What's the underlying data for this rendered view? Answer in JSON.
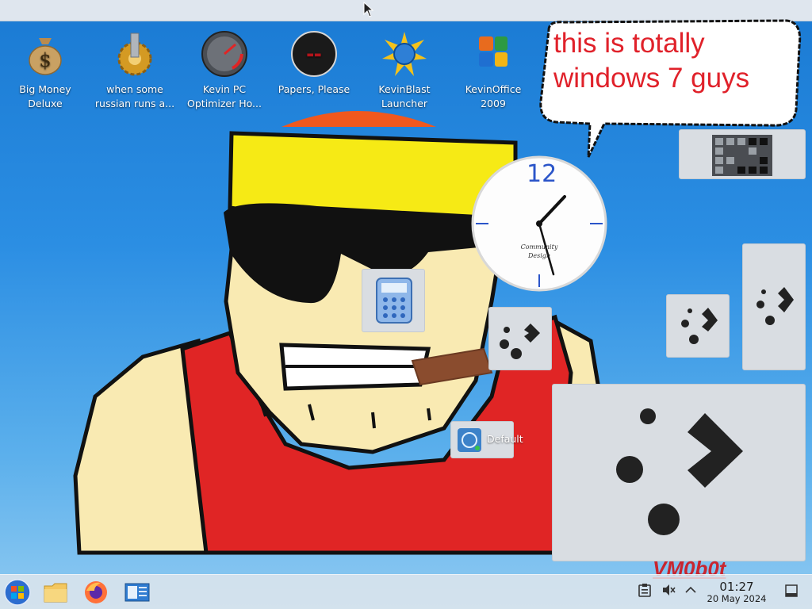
{
  "desktop": {
    "icons": [
      {
        "label": "Big Money\nDeluxe",
        "icon": "money-bag-icon"
      },
      {
        "label": "when some\nrussian runs a...",
        "icon": "gear-icon"
      },
      {
        "label": "Kevin PC\nOptimizer Ho...",
        "icon": "speedometer-icon"
      },
      {
        "label": "Papers, Please",
        "icon": "papers-please-icon"
      },
      {
        "label": "KevinBlast\nLauncher",
        "icon": "blast-launcher-icon"
      },
      {
        "label": "KevinOffice\n2009",
        "icon": "office-icon"
      }
    ],
    "speech_bubble": "this is totally\nwindows 7 guys",
    "clock_widget": {
      "numeral": "12",
      "brand": "Community\nDesign",
      "time": "01:27"
    },
    "default_widget_label": "Default",
    "vm_logo": "VM0b0t"
  },
  "taskbar": {
    "pinned": [
      {
        "name": "start-button",
        "icon": "windows-orb-icon"
      },
      {
        "name": "file-explorer-button",
        "icon": "folder-icon"
      },
      {
        "name": "firefox-button",
        "icon": "firefox-icon"
      },
      {
        "name": "system-settings-button",
        "icon": "control-panel-icon"
      }
    ],
    "clock": {
      "time": "01:27",
      "date": "20 May 2024"
    }
  },
  "colors": {
    "bubble_text": "#e0212a",
    "widget_bg": "#d9dde2",
    "taskbar_bg": "#e2e6ec"
  }
}
